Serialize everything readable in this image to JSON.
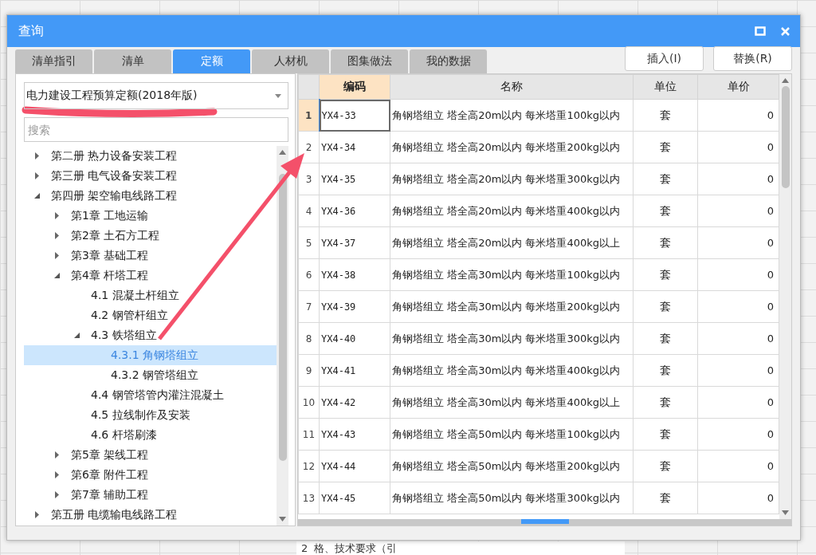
{
  "window": {
    "title": "查询"
  },
  "tabs": [
    {
      "label": "清单指引",
      "selected": false
    },
    {
      "label": "清单",
      "selected": false
    },
    {
      "label": "定额",
      "selected": true
    },
    {
      "label": "人材机",
      "selected": false
    },
    {
      "label": "图集做法",
      "selected": false
    },
    {
      "label": "我的数据",
      "selected": false
    }
  ],
  "buttons": [
    "插入(I)",
    "替换(R)"
  ],
  "library_select": {
    "value": "电力建设工程预算定额(2018年版)"
  },
  "search": {
    "placeholder": "搜索"
  },
  "tree": [
    {
      "label": "第二册 热力设备安装工程",
      "expanded": false,
      "selected": false,
      "has_children": true
    },
    {
      "label": "第三册 电气设备安装工程",
      "expanded": false,
      "selected": false,
      "has_children": true
    },
    {
      "label": "第四册 架空输电线路工程",
      "expanded": true,
      "selected": false,
      "has_children": true,
      "children": [
        {
          "label": "第1章 工地运输",
          "expanded": false,
          "selected": false,
          "has_children": true
        },
        {
          "label": "第2章 土石方工程",
          "expanded": false,
          "selected": false,
          "has_children": true
        },
        {
          "label": "第3章 基础工程",
          "expanded": false,
          "selected": false,
          "has_children": true
        },
        {
          "label": "第4章 杆塔工程",
          "expanded": true,
          "selected": false,
          "has_children": true,
          "children": [
            {
              "label": "4.1 混凝土杆组立",
              "expanded": false,
              "selected": false,
              "has_children": false
            },
            {
              "label": "4.2 钢管杆组立",
              "expanded": false,
              "selected": false,
              "has_children": false
            },
            {
              "label": "4.3 铁塔组立",
              "expanded": true,
              "selected": false,
              "has_children": true,
              "children": [
                {
                  "label": "4.3.1 角钢塔组立",
                  "expanded": false,
                  "selected": true,
                  "has_children": false
                },
                {
                  "label": "4.3.2 钢管塔组立",
                  "expanded": false,
                  "selected": false,
                  "has_children": false
                }
              ]
            },
            {
              "label": "4.4 钢管塔管内灌注混凝土",
              "expanded": false,
              "selected": false,
              "has_children": false
            },
            {
              "label": "4.5 拉线制作及安装",
              "expanded": false,
              "selected": false,
              "has_children": false
            },
            {
              "label": "4.6 杆塔刷漆",
              "expanded": false,
              "selected": false,
              "has_children": false
            }
          ]
        },
        {
          "label": "第5章 架线工程",
          "expanded": false,
          "selected": false,
          "has_children": true
        },
        {
          "label": "第6章 附件工程",
          "expanded": false,
          "selected": false,
          "has_children": true
        },
        {
          "label": "第7章 辅助工程",
          "expanded": false,
          "selected": false,
          "has_children": true
        }
      ]
    },
    {
      "label": "第五册 电缆输电线路工程",
      "expanded": false,
      "selected": false,
      "has_children": true
    }
  ],
  "table": {
    "columns": [
      {
        "label": "编码",
        "selected": true
      },
      {
        "label": "名称",
        "selected": false
      },
      {
        "label": "单位",
        "selected": false
      },
      {
        "label": "单价",
        "selected": false
      }
    ],
    "rows": [
      {
        "num": "1",
        "code": "YX4-33",
        "name": "角钢塔组立 塔全高20m以内 每米塔重100kg以内",
        "unit": "套",
        "price": "0",
        "selected": true
      },
      {
        "num": "2",
        "code": "YX4-34",
        "name": "角钢塔组立 塔全高20m以内 每米塔重200kg以内",
        "unit": "套",
        "price": "0",
        "selected": false
      },
      {
        "num": "3",
        "code": "YX4-35",
        "name": "角钢塔组立 塔全高20m以内 每米塔重300kg以内",
        "unit": "套",
        "price": "0",
        "selected": false
      },
      {
        "num": "4",
        "code": "YX4-36",
        "name": "角钢塔组立 塔全高20m以内 每米塔重400kg以内",
        "unit": "套",
        "price": "0",
        "selected": false
      },
      {
        "num": "5",
        "code": "YX4-37",
        "name": "角钢塔组立 塔全高20m以内 每米塔重400kg以上",
        "unit": "套",
        "price": "0",
        "selected": false
      },
      {
        "num": "6",
        "code": "YX4-38",
        "name": "角钢塔组立 塔全高30m以内 每米塔重100kg以内",
        "unit": "套",
        "price": "0",
        "selected": false
      },
      {
        "num": "7",
        "code": "YX4-39",
        "name": "角钢塔组立 塔全高30m以内 每米塔重200kg以内",
        "unit": "套",
        "price": "0",
        "selected": false
      },
      {
        "num": "8",
        "code": "YX4-40",
        "name": "角钢塔组立 塔全高30m以内 每米塔重300kg以内",
        "unit": "套",
        "price": "0",
        "selected": false
      },
      {
        "num": "9",
        "code": "YX4-41",
        "name": "角钢塔组立 塔全高30m以内 每米塔重400kg以内",
        "unit": "套",
        "price": "0",
        "selected": false
      },
      {
        "num": "10",
        "code": "YX4-42",
        "name": "角钢塔组立 塔全高30m以内 每米塔重400kg以上",
        "unit": "套",
        "price": "0",
        "selected": false
      },
      {
        "num": "11",
        "code": "YX4-43",
        "name": "角钢塔组立 塔全高50m以内 每米塔重100kg以内",
        "unit": "套",
        "price": "0",
        "selected": false
      },
      {
        "num": "12",
        "code": "YX4-44",
        "name": "角钢塔组立 塔全高50m以内 每米塔重200kg以内",
        "unit": "套",
        "price": "0",
        "selected": false
      },
      {
        "num": "13",
        "code": "YX4-45",
        "name": "角钢塔组立 塔全高50m以内 每米塔重300kg以内",
        "unit": "套",
        "price": "0",
        "selected": false
      }
    ]
  },
  "background_row": {
    "num": "2",
    "text": "格、技术要求（引"
  }
}
